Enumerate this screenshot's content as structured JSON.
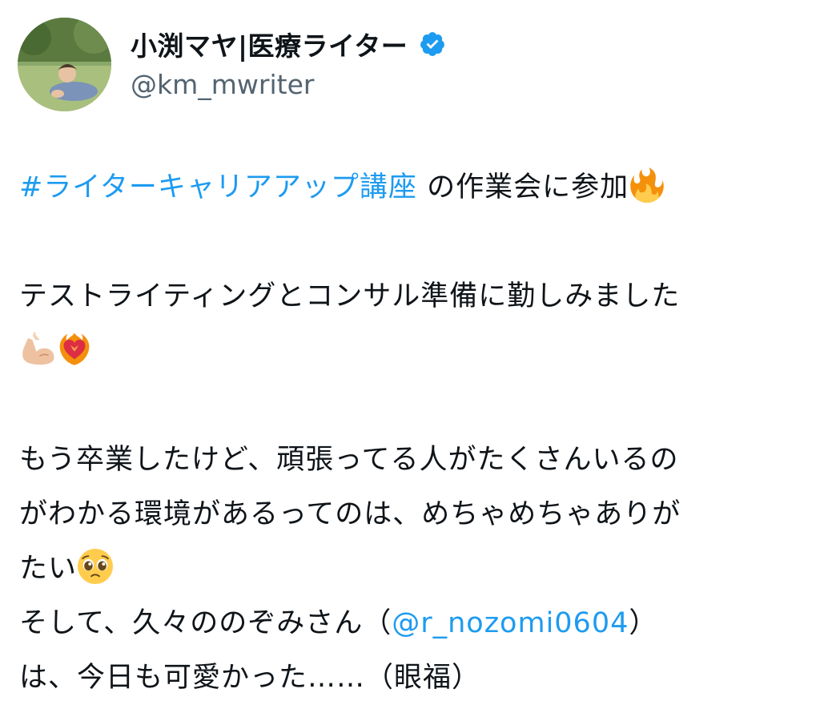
{
  "author": {
    "display_name": "小渕マヤ|医療ライター",
    "handle": "@km_mwriter",
    "verified": true
  },
  "tweet": {
    "hashtag": "#ライターキャリアアップ講座",
    "line1_text": " の作業会に参加",
    "line2_text": "テストライティングとコンサル準備に勤しみました",
    "line4_text": "もう卒業したけど、頑張ってる人がたくさんいるの",
    "line5_text": "がわかる環境があるってのは、めちゃめちゃありが",
    "line6_text": "たい",
    "line7_prefix": "そして、久々ののぞみさん（",
    "mention": "@r_nozomi0604",
    "line7_suffix": "）",
    "line8_text": "は、今日も可愛かった……（眼福）",
    "emojis": [
      "fire-emoji",
      "flexed-biceps-emoji",
      "heart-on-fire-emoji",
      "pleading-face-emoji"
    ]
  },
  "colors": {
    "link": "#1d9bf0",
    "verified_badge": "#1d9bf0",
    "handle": "#536471",
    "text": "#0f1419"
  }
}
